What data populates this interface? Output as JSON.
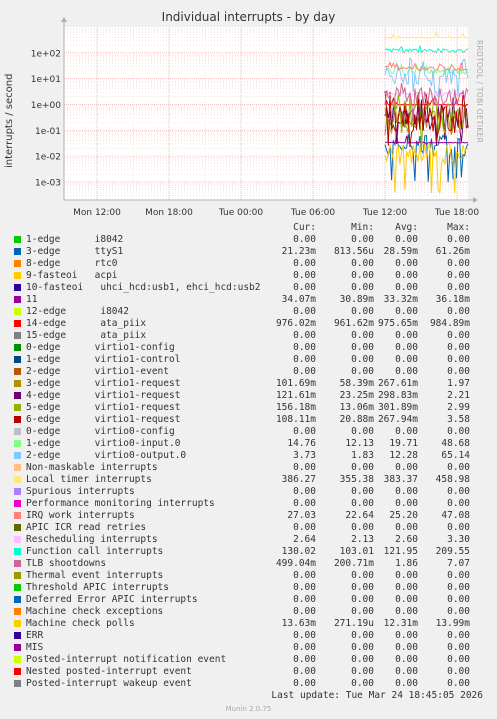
{
  "chart_data": {
    "type": "line",
    "title": "Individual interrupts - by day",
    "ylabel": "interrupts / second",
    "yscale": "log",
    "ylim": [
      0.0002,
      1000
    ],
    "y_ticks": [
      "1e+02",
      "1e+01",
      "1e+00",
      "1e-01",
      "1e-02",
      "1e-03"
    ],
    "x_ticks": [
      "Mon 12:00",
      "Mon 18:00",
      "Tue 00:00",
      "Tue 06:00",
      "Tue 12:00",
      "Tue 18:00"
    ],
    "data_start": "Tue 12:00",
    "watermark": "RRDTOOL / TOBI OETIKER",
    "columns": [
      "Cur:",
      "Min:",
      "Avg:",
      "Max:"
    ],
    "series": [
      {
        "name": "1-edge      i8042",
        "color": "#00cc00",
        "cur": "0.00",
        "min": "0.00",
        "avg": "0.00",
        "max": "0.00"
      },
      {
        "name": "3-edge      ttyS1",
        "color": "#0066b3",
        "cur": "21.23m",
        "min": "813.56u",
        "avg": "28.59m",
        "max": "61.26m"
      },
      {
        "name": "8-edge      rtc0",
        "color": "#ff8000",
        "cur": "0.00",
        "min": "0.00",
        "avg": "0.00",
        "max": "0.00"
      },
      {
        "name": "9-fasteoi   acpi",
        "color": "#ffcc00",
        "cur": "0.00",
        "min": "0.00",
        "avg": "0.00",
        "max": "0.00"
      },
      {
        "name": "10-fasteoi   uhci_hcd:usb1, ehci_hcd:usb2",
        "color": "#330099",
        "cur": "0.00",
        "min": "0.00",
        "avg": "0.00",
        "max": "0.00"
      },
      {
        "name": "11",
        "color": "#990099",
        "cur": "34.07m",
        "min": "30.89m",
        "avg": "33.32m",
        "max": "36.18m"
      },
      {
        "name": "12-edge      i8042",
        "color": "#ccff00",
        "cur": "0.00",
        "min": "0.00",
        "avg": "0.00",
        "max": "0.00"
      },
      {
        "name": "14-edge      ata_piix",
        "color": "#ff0000",
        "cur": "976.02m",
        "min": "961.62m",
        "avg": "975.65m",
        "max": "984.89m"
      },
      {
        "name": "15-edge      ata_piix",
        "color": "#808080",
        "cur": "0.00",
        "min": "0.00",
        "avg": "0.00",
        "max": "0.00"
      },
      {
        "name": "0-edge      virtio1-config",
        "color": "#008f00",
        "cur": "0.00",
        "min": "0.00",
        "avg": "0.00",
        "max": "0.00"
      },
      {
        "name": "1-edge      virtio1-control",
        "color": "#00487d",
        "cur": "0.00",
        "min": "0.00",
        "avg": "0.00",
        "max": "0.00"
      },
      {
        "name": "2-edge      virtio1-event",
        "color": "#b35a00",
        "cur": "0.00",
        "min": "0.00",
        "avg": "0.00",
        "max": "0.00"
      },
      {
        "name": "3-edge      virtio1-request",
        "color": "#b38f00",
        "cur": "101.69m",
        "min": "58.39m",
        "avg": "267.61m",
        "max": "1.97"
      },
      {
        "name": "4-edge      virtio1-request",
        "color": "#6b006b",
        "cur": "121.61m",
        "min": "23.25m",
        "avg": "298.83m",
        "max": "2.21"
      },
      {
        "name": "5-edge      virtio1-request",
        "color": "#8fb300",
        "cur": "156.18m",
        "min": "13.06m",
        "avg": "301.89m",
        "max": "2.99"
      },
      {
        "name": "6-edge      virtio1-request",
        "color": "#b30000",
        "cur": "108.11m",
        "min": "20.88m",
        "avg": "267.94m",
        "max": "3.58"
      },
      {
        "name": "0-edge      virtio0-config",
        "color": "#bebebe",
        "cur": "0.00",
        "min": "0.00",
        "avg": "0.00",
        "max": "0.00"
      },
      {
        "name": "1-edge      virtio0-input.0",
        "color": "#80ff80",
        "cur": "14.76",
        "min": "12.13",
        "avg": "19.71",
        "max": "48.68"
      },
      {
        "name": "2-edge      virtio0-output.0",
        "color": "#80c9ff",
        "cur": "3.73",
        "min": "1.83",
        "avg": "12.28",
        "max": "65.14"
      },
      {
        "name": "Non-maskable interrupts",
        "color": "#ffc080",
        "cur": "0.00",
        "min": "0.00",
        "avg": "0.00",
        "max": "0.00"
      },
      {
        "name": "Local timer interrupts",
        "color": "#ffe680",
        "cur": "386.27",
        "min": "355.38",
        "avg": "383.37",
        "max": "458.98"
      },
      {
        "name": "Spurious interrupts",
        "color": "#aa80ff",
        "cur": "0.00",
        "min": "0.00",
        "avg": "0.00",
        "max": "0.00"
      },
      {
        "name": "Performance monitoring interrupts",
        "color": "#ee00cc",
        "cur": "0.00",
        "min": "0.00",
        "avg": "0.00",
        "max": "0.00"
      },
      {
        "name": "IRQ work interrupts",
        "color": "#ff8080",
        "cur": "27.03",
        "min": "22.64",
        "avg": "25.20",
        "max": "47.08"
      },
      {
        "name": "APIC ICR read retries",
        "color": "#666600",
        "cur": "0.00",
        "min": "0.00",
        "avg": "0.00",
        "max": "0.00"
      },
      {
        "name": "Rescheduling interrupts",
        "color": "#ffbfff",
        "cur": "2.64",
        "min": "2.13",
        "avg": "2.60",
        "max": "3.30"
      },
      {
        "name": "Function call interrupts",
        "color": "#00ffcc",
        "cur": "130.02",
        "min": "103.01",
        "avg": "121.95",
        "max": "209.55"
      },
      {
        "name": "TLB shootdowns",
        "color": "#cc6699",
        "cur": "499.04m",
        "min": "200.71m",
        "avg": "1.86",
        "max": "7.07"
      },
      {
        "name": "Thermal event interrupts",
        "color": "#999900",
        "cur": "0.00",
        "min": "0.00",
        "avg": "0.00",
        "max": "0.00"
      },
      {
        "name": "Threshold APIC interrupts",
        "color": "#00cc00",
        "cur": "0.00",
        "min": "0.00",
        "avg": "0.00",
        "max": "0.00"
      },
      {
        "name": "Deferred Error APIC interrupts",
        "color": "#0066b3",
        "cur": "0.00",
        "min": "0.00",
        "avg": "0.00",
        "max": "0.00"
      },
      {
        "name": "Machine check exceptions",
        "color": "#ff8000",
        "cur": "0.00",
        "min": "0.00",
        "avg": "0.00",
        "max": "0.00"
      },
      {
        "name": "Machine check polls",
        "color": "#ffcc00",
        "cur": "13.63m",
        "min": "271.19u",
        "avg": "12.31m",
        "max": "13.99m"
      },
      {
        "name": "ERR",
        "color": "#330099",
        "cur": "0.00",
        "min": "0.00",
        "avg": "0.00",
        "max": "0.00"
      },
      {
        "name": "MIS",
        "color": "#990099",
        "cur": "0.00",
        "min": "0.00",
        "avg": "0.00",
        "max": "0.00"
      },
      {
        "name": "Posted-interrupt notification event",
        "color": "#ccff00",
        "cur": "0.00",
        "min": "0.00",
        "avg": "0.00",
        "max": "0.00"
      },
      {
        "name": "Nested posted-interrupt event",
        "color": "#ff0000",
        "cur": "0.00",
        "min": "0.00",
        "avg": "0.00",
        "max": "0.00"
      },
      {
        "name": "Posted-interrupt wakeup event",
        "color": "#808080",
        "cur": "0.00",
        "min": "0.00",
        "avg": "0.00",
        "max": "0.00"
      }
    ]
  },
  "footer": {
    "last_update": "Last update: Tue Mar 24 18:45:05 2026",
    "version": "Munin 2.0.75"
  }
}
